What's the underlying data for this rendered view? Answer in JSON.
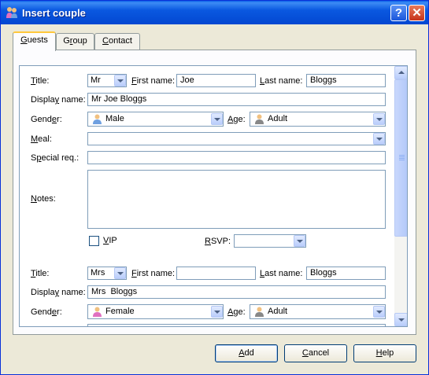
{
  "window": {
    "title": "Insert couple",
    "help_glyph": "?",
    "close_glyph": "✕"
  },
  "tabs": [
    {
      "label": "Guests",
      "mnemonic": "G",
      "rest": "uests"
    },
    {
      "label": "Group",
      "mnemonic": "r",
      "before": "G",
      "rest": "oup"
    },
    {
      "label": "Contact",
      "mnemonic": "C",
      "rest": "ontact"
    }
  ],
  "guest1": {
    "title_label": {
      "mn": "T",
      "rest": "itle:"
    },
    "title_value": "Mr",
    "first_name_label": {
      "mn": "F",
      "rest": "irst name:"
    },
    "first_name_value": "Joe",
    "last_name_label": {
      "mn": "L",
      "rest": "ast name:"
    },
    "last_name_value": "Bloggs",
    "display_name_label": {
      "before": "Displa",
      "mn": "y",
      "rest": " name:"
    },
    "display_name_value": "Mr Joe Bloggs",
    "gender_label": {
      "before": "Gend",
      "mn": "e",
      "rest": "r:"
    },
    "gender_value": "Male",
    "gender_icon": "male-person-icon",
    "age_label": {
      "mn": "A",
      "rest": "ge:"
    },
    "age_value": "Adult",
    "meal_label": {
      "mn": "M",
      "rest": "eal:"
    },
    "meal_value": "",
    "special_label": {
      "before": "S",
      "mn": "p",
      "rest": "ecial req.:"
    },
    "special_value": "",
    "notes_label": {
      "mn": "N",
      "rest": "otes:"
    },
    "notes_value": "",
    "vip_label": {
      "mn": "V",
      "rest": "IP"
    },
    "vip_checked": false,
    "rsvp_label": {
      "mn": "R",
      "rest": "SVP:"
    },
    "rsvp_value": ""
  },
  "guest2": {
    "title_label": {
      "mn": "T",
      "rest": "itle:"
    },
    "title_value": "Mrs",
    "first_name_label": {
      "mn": "F",
      "rest": "irst name:"
    },
    "first_name_value": "",
    "last_name_label": {
      "mn": "L",
      "rest": "ast name:"
    },
    "last_name_value": "Bloggs",
    "display_name_label": {
      "before": "Displa",
      "mn": "y",
      "rest": " name:"
    },
    "display_name_value": "Mrs  Bloggs",
    "gender_label": {
      "before": "Gend",
      "mn": "e",
      "rest": "r:"
    },
    "gender_value": "Female",
    "gender_icon": "female-person-icon",
    "age_label": {
      "mn": "A",
      "rest": "ge:"
    },
    "age_value": "Adult"
  },
  "buttons": {
    "add": {
      "mn": "A",
      "rest": "dd"
    },
    "cancel": {
      "mn": "C",
      "rest": "ancel"
    },
    "help": {
      "mn": "H",
      "rest": "elp"
    }
  },
  "colors": {
    "titlebar": "#0a58e0",
    "tab_highlight": "#ffc83c",
    "male": "#6fa0e0",
    "female": "#e070c0",
    "skin": "#f0c080"
  }
}
